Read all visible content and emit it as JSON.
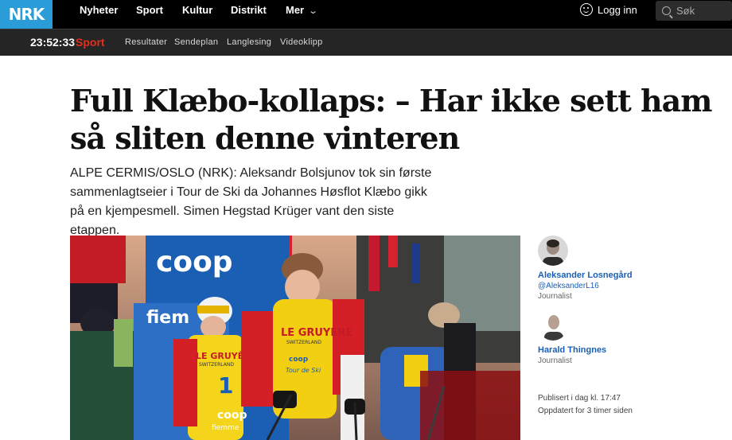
{
  "topnav": {
    "logo": "NRK",
    "items": [
      "Nyheter",
      "Sport",
      "Kultur",
      "Distrikt",
      "Mer"
    ],
    "login_label": "Logg inn",
    "search_placeholder": "Søk"
  },
  "subnav": {
    "clock": "23:52:33",
    "section": "Sport",
    "links": [
      "Resultater",
      "Sendeplan",
      "Langlesing",
      "Videoklipp"
    ]
  },
  "article": {
    "headline": "Full Klæbo-kollaps: – Har ikke sett ham så sliten denne vinteren",
    "lead": "ALPE CERMIS/OSLO (NRK): Aleksandr Bolsjunov tok sin første sammenlagtseier i Tour de Ski da Johannes Høsflot Klæbo gikk på en kjempesmell. Simen Hegstad Krüger vant den siste etappen."
  },
  "image_text": {
    "sponsor": "coop",
    "sponsor2": "fiem",
    "bib_sponsor": "LE GRUYÈRE",
    "bib_sub": "SWITZERLAND",
    "bib_sponsor2": "LE GRUYÈRE",
    "bib_sub2": "SWITZERLAND",
    "bib_number": "1",
    "bib_coop": "coop",
    "bib_coop2": "coop",
    "tour": "Tour de Ski",
    "fiemme": "fiemme"
  },
  "authors": [
    {
      "name": "Aleksander Losnegård",
      "handle": "@AleksanderL16",
      "role": "Journalist"
    },
    {
      "name": "Harald Thingnes",
      "handle": "",
      "role": "Journalist"
    }
  ],
  "meta": {
    "published": "Publisert i dag kl. 17:47",
    "updated": "Oppdatert for 3 timer siden"
  },
  "colors": {
    "brand_blue": "#2a9dd8",
    "sport_red": "#e3301e",
    "link_blue": "#1a5fb4"
  }
}
